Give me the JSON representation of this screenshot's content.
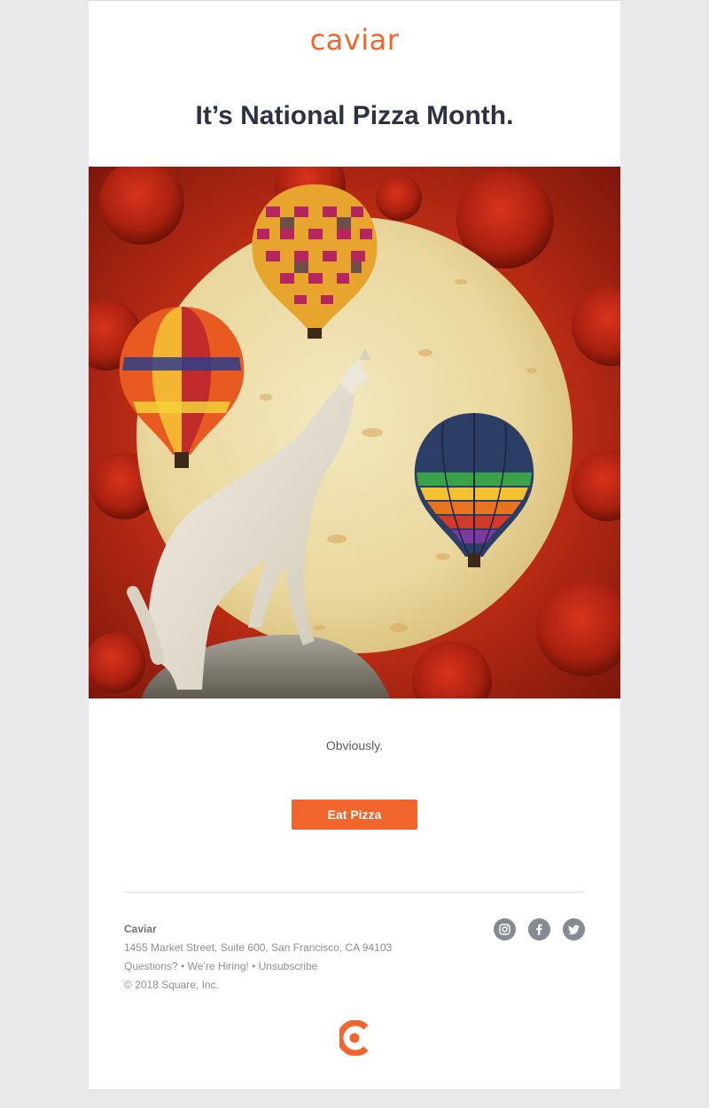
{
  "brand": {
    "logo_text": "caviar",
    "accent_color": "#f2652d"
  },
  "headline": "It’s National Pizza Month.",
  "hero_image": {
    "description_icon": "pizza-wolf-balloons-illustration"
  },
  "tagline": "Obviously.",
  "cta": {
    "label": "Eat Pizza"
  },
  "footer": {
    "company": "Caviar",
    "address": "1455 Market Street, Suite 600, San Francisco, CA 94103",
    "links": {
      "questions": "Questions?",
      "hiring": "We’re Hiring!",
      "unsubscribe": "Unsubscribe",
      "separator": "•"
    },
    "copyright": "© 2018 Square, Inc."
  },
  "social": [
    {
      "icon": "instagram-icon"
    },
    {
      "icon": "facebook-icon"
    },
    {
      "icon": "twitter-icon"
    }
  ]
}
